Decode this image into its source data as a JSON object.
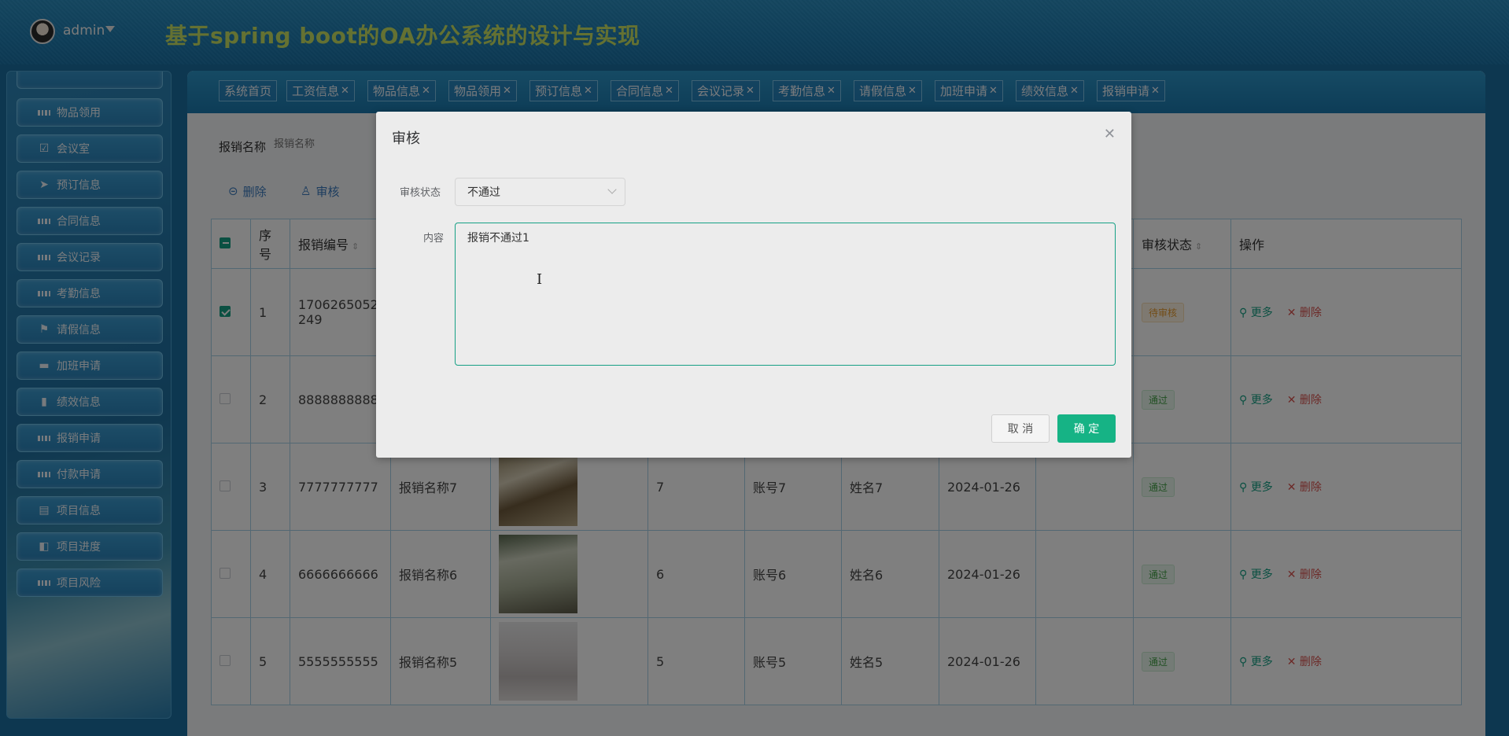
{
  "header": {
    "user": "admin",
    "app_title": "基于spring boot的OA办公系统的设计与实现"
  },
  "sidebar": {
    "items": [
      {
        "label": "物品领用",
        "icon": "grid-icon"
      },
      {
        "label": "会议室",
        "icon": "clipboard-check-icon"
      },
      {
        "label": "预订信息",
        "icon": "paper-plane-icon"
      },
      {
        "label": "合同信息",
        "icon": "grid-icon"
      },
      {
        "label": "会议记录",
        "icon": "grid-icon"
      },
      {
        "label": "考勤信息",
        "icon": "grid-icon"
      },
      {
        "label": "请假信息",
        "icon": "flag-icon"
      },
      {
        "label": "加班申请",
        "icon": "briefcase-icon"
      },
      {
        "label": "绩效信息",
        "icon": "book-icon"
      },
      {
        "label": "报销申请",
        "icon": "grid-icon"
      },
      {
        "label": "付款申请",
        "icon": "grid-icon"
      },
      {
        "label": "项目信息",
        "icon": "clipboard-icon"
      },
      {
        "label": "项目进度",
        "icon": "wallet-icon"
      },
      {
        "label": "项目风险",
        "icon": "grid-icon"
      }
    ]
  },
  "tabs": [
    "系统首页",
    "工资信息",
    "物品信息",
    "物品领用",
    "预订信息",
    "合同信息",
    "会议记录",
    "考勤信息",
    "请假信息",
    "加班申请",
    "绩效信息",
    "报销申请"
  ],
  "search": {
    "label": "报销名称",
    "placeholder": "报销名称"
  },
  "toolbar": {
    "delete_label": "删除",
    "audit_label": "审核"
  },
  "table": {
    "headers": {
      "index": "序号",
      "code": "报销编号",
      "status": "审核状态",
      "actions": "操作"
    },
    "rows": [
      {
        "index": "1",
        "code": "1706265052249",
        "name": "",
        "amount": "",
        "account": "",
        "person": "",
        "date": "",
        "status": "待审核",
        "status_type": "wait",
        "checked": true
      },
      {
        "index": "2",
        "code": "8888888888",
        "name": "",
        "amount": "",
        "account": "",
        "person": "",
        "date": "",
        "status": "通过",
        "status_type": "ok",
        "checked": false
      },
      {
        "index": "3",
        "code": "7777777777",
        "name": "报销名称7",
        "amount": "7",
        "account": "账号7",
        "person": "姓名7",
        "date": "2024-01-26",
        "status": "通过",
        "status_type": "ok",
        "checked": false
      },
      {
        "index": "4",
        "code": "6666666666",
        "name": "报销名称6",
        "amount": "6",
        "account": "账号6",
        "person": "姓名6",
        "date": "2024-01-26",
        "status": "通过",
        "status_type": "ok",
        "checked": false
      },
      {
        "index": "5",
        "code": "5555555555",
        "name": "报销名称5",
        "amount": "5",
        "account": "账号5",
        "person": "姓名5",
        "date": "2024-01-26",
        "status": "通过",
        "status_type": "ok",
        "checked": false
      }
    ],
    "more_label": "更多",
    "delete_label": "删除"
  },
  "modal": {
    "title": "审核",
    "status_label": "审核状态",
    "status_value": "不通过",
    "content_label": "内容",
    "content_value": "报销不通过1",
    "cancel_label": "取 消",
    "ok_label": "确 定"
  }
}
